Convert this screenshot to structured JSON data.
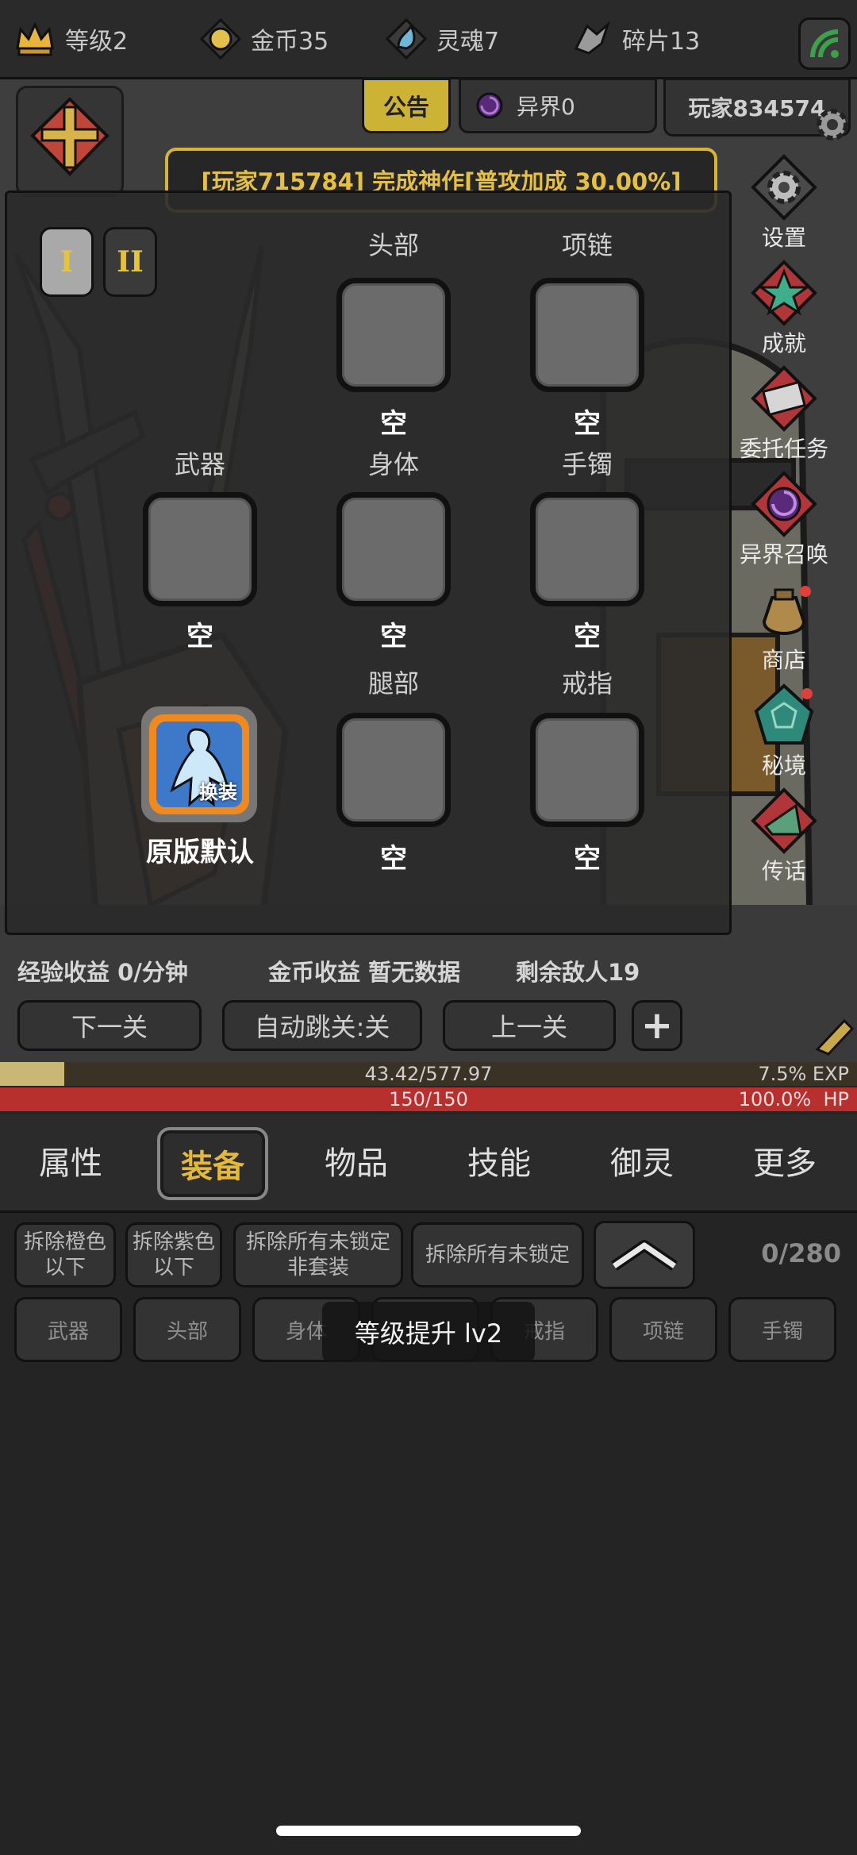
{
  "resources": {
    "level": "等级2",
    "gold": "金币35",
    "soul": "灵魂7",
    "fragment": "碎片13"
  },
  "tabs": {
    "notice": "公告",
    "otherworld": "异界0",
    "player": "玩家834574"
  },
  "banner": "[玩家715784] 完成神作[普攻加成 30.00%]",
  "equip_pages": [
    "I",
    "II"
  ],
  "slots": {
    "head": {
      "label": "头部",
      "state": "空"
    },
    "necklace": {
      "label": "项链",
      "state": "空"
    },
    "weapon": {
      "label": "武器",
      "state": "空"
    },
    "body": {
      "label": "身体",
      "state": "空"
    },
    "bracelet": {
      "label": "手镯",
      "state": "空"
    },
    "legs": {
      "label": "腿部",
      "state": "空"
    },
    "ring": {
      "label": "戒指",
      "state": "空"
    }
  },
  "outfit": {
    "badge": "换装",
    "name": "原版默认"
  },
  "side_menu": [
    "设置",
    "成就",
    "委托任务",
    "异界召唤",
    "商店",
    "秘境",
    "传话"
  ],
  "stats": {
    "exp_income": "经验收益 0/分钟",
    "gold_income": "金币收益 暂无数据",
    "enemies_left": "剩余敌人19"
  },
  "nav": {
    "next": "下一关",
    "auto": "自动跳关:关",
    "prev": "上一关",
    "add": "+"
  },
  "exp_bar": {
    "text": "43.42/577.97",
    "percent_text": "7.5% EXP",
    "fraction": 0.075
  },
  "hp_bar": {
    "text": "150/150",
    "percent_text": "100.0%  HP",
    "fraction": 1.0
  },
  "main_tabs": [
    "属性",
    "装备",
    "物品",
    "技能",
    "御灵",
    "更多"
  ],
  "filters": {
    "orange": "拆除橙色\n以下",
    "purple": "拆除紫色\n以下",
    "unlocked_nonset": "拆除所有未锁定\n非套装",
    "unlocked_all": "拆除所有未锁定",
    "capacity": "0/280"
  },
  "slot_filters": [
    "武器",
    "头部",
    "身体",
    "戒指",
    "项链",
    "手镯"
  ],
  "toast": "等级提升 lv2",
  "colors": {
    "accent_gold": "#d9b332",
    "hp_red": "#b8302e",
    "orange": "#f08a1e"
  }
}
